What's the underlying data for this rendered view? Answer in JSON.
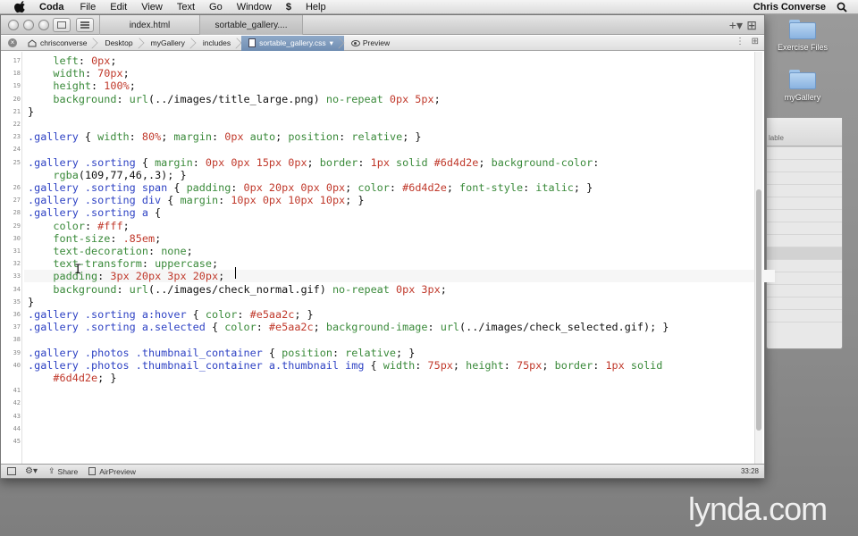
{
  "menubar": {
    "app_name": "Coda",
    "items": [
      "File",
      "Edit",
      "View",
      "Text",
      "Go",
      "Window",
      "Help"
    ],
    "script_glyph": "$",
    "user": "Chris Converse"
  },
  "desktop": {
    "icons": [
      "Exercise Files",
      "myGallery"
    ],
    "bg_window_label": "lable"
  },
  "tabs": [
    {
      "label": "index.html",
      "active": false
    },
    {
      "label": "sortable_gallery....",
      "active": true
    }
  ],
  "pathbar": {
    "crumbs": [
      "chrisconverse",
      "Desktop",
      "myGallery",
      "includes",
      "sortable_gallery.css"
    ],
    "dropdown_glyph": "▾",
    "preview_label": "Preview"
  },
  "editor": {
    "current_line": 33,
    "lines": [
      {
        "n": "17",
        "html": "    <span class='k'>left</span>: <span class='v'>0px</span>;"
      },
      {
        "n": "18",
        "html": "    <span class='k'>width</span>: <span class='v'>70px</span>;"
      },
      {
        "n": "19",
        "html": "    <span class='k'>height</span>: <span class='v'>100%</span>;"
      },
      {
        "n": "20",
        "html": "    <span class='k'>background</span>: <span class='w'>url</span>(../images/title_large.png) <span class='w'>no-repeat</span> <span class='v'>0px 5px</span>;"
      },
      {
        "n": "21",
        "html": "}"
      },
      {
        "n": "22",
        "html": ""
      },
      {
        "n": "23",
        "html": "<span class='s'>.gallery</span> { <span class='k'>width</span>: <span class='v'>80%</span>; <span class='k'>margin</span>: <span class='v'>0px</span> <span class='w'>auto</span>; <span class='k'>position</span>: <span class='w'>relative</span>; }"
      },
      {
        "n": "24",
        "html": ""
      },
      {
        "n": "25",
        "html": "<span class='s'>.gallery .sorting</span> { <span class='k'>margin</span>: <span class='v'>0px 0px 15px 0px</span>; <span class='k'>border</span>: <span class='v'>1px</span> <span class='w'>solid</span> <span class='v'>#6d4d2e</span>; <span class='k'>background-color</span>:"
      },
      {
        "n": "",
        "html": "    <span class='w'>rgba</span>(109,77,46,.3); }"
      },
      {
        "n": "26",
        "html": "<span class='s'>.gallery .sorting span</span> { <span class='k'>padding</span>: <span class='v'>0px 20px 0px 0px</span>; <span class='k'>color</span>: <span class='v'>#6d4d2e</span>; <span class='k'>font-style</span>: <span class='w'>italic</span>; }"
      },
      {
        "n": "27",
        "html": "<span class='s'>.gallery .sorting div</span> { <span class='k'>margin</span>: <span class='v'>10px 0px 10px 10px</span>; }"
      },
      {
        "n": "28",
        "html": "<span class='s'>.gallery .sorting a</span> {"
      },
      {
        "n": "29",
        "html": "    <span class='k'>color</span>: <span class='v'>#fff</span>;"
      },
      {
        "n": "30",
        "html": "    <span class='k'>font-size</span>: <span class='v'>.85em</span>;"
      },
      {
        "n": "31",
        "html": "    <span class='k'>text-decoration</span>: <span class='w'>none</span>;"
      },
      {
        "n": "32",
        "html": "    <span class='k'>text-transform</span>: <span class='w'>uppercase</span>;"
      },
      {
        "n": "33",
        "html": "    <span class='k'>padding</span>: <span class='v'>3px 20px 3px 20px</span>;"
      },
      {
        "n": "34",
        "html": "    <span class='k'>background</span>: <span class='w'>url</span>(../images/check_normal.gif) <span class='w'>no-repeat</span> <span class='v'>0px 3px</span>;"
      },
      {
        "n": "35",
        "html": "}"
      },
      {
        "n": "36",
        "html": "<span class='s'>.gallery .sorting a:hover</span> { <span class='k'>color</span>: <span class='v'>#e5aa2c</span>; }"
      },
      {
        "n": "37",
        "html": "<span class='s'>.gallery .sorting a.selected</span> { <span class='k'>color</span>: <span class='v'>#e5aa2c</span>; <span class='k'>background-image</span>: <span class='w'>url</span>(../images/check_selected.gif); }"
      },
      {
        "n": "38",
        "html": ""
      },
      {
        "n": "39",
        "html": "<span class='s'>.gallery .photos .thumbnail_container</span> { <span class='k'>position</span>: <span class='w'>relative</span>; }"
      },
      {
        "n": "40",
        "html": "<span class='s'>.gallery .photos .thumbnail_container a.thumbnail img</span> { <span class='k'>width</span>: <span class='v'>75px</span>; <span class='k'>height</span>: <span class='v'>75px</span>; <span class='k'>border</span>: <span class='v'>1px</span> <span class='w'>solid</span>"
      },
      {
        "n": "",
        "html": "    <span class='v'>#6d4d2e</span>; }"
      },
      {
        "n": "41",
        "html": ""
      },
      {
        "n": "42",
        "html": ""
      },
      {
        "n": "43",
        "html": ""
      },
      {
        "n": "44",
        "html": ""
      },
      {
        "n": "45",
        "html": ""
      }
    ]
  },
  "statusbar": {
    "share_label": "Share",
    "airpreview_label": "AirPreview",
    "position": "33:28"
  },
  "watermark": "lynda.com",
  "colors": {
    "selector": "#2f43c4",
    "property": "#3a8a3a",
    "value": "#c0392b"
  }
}
